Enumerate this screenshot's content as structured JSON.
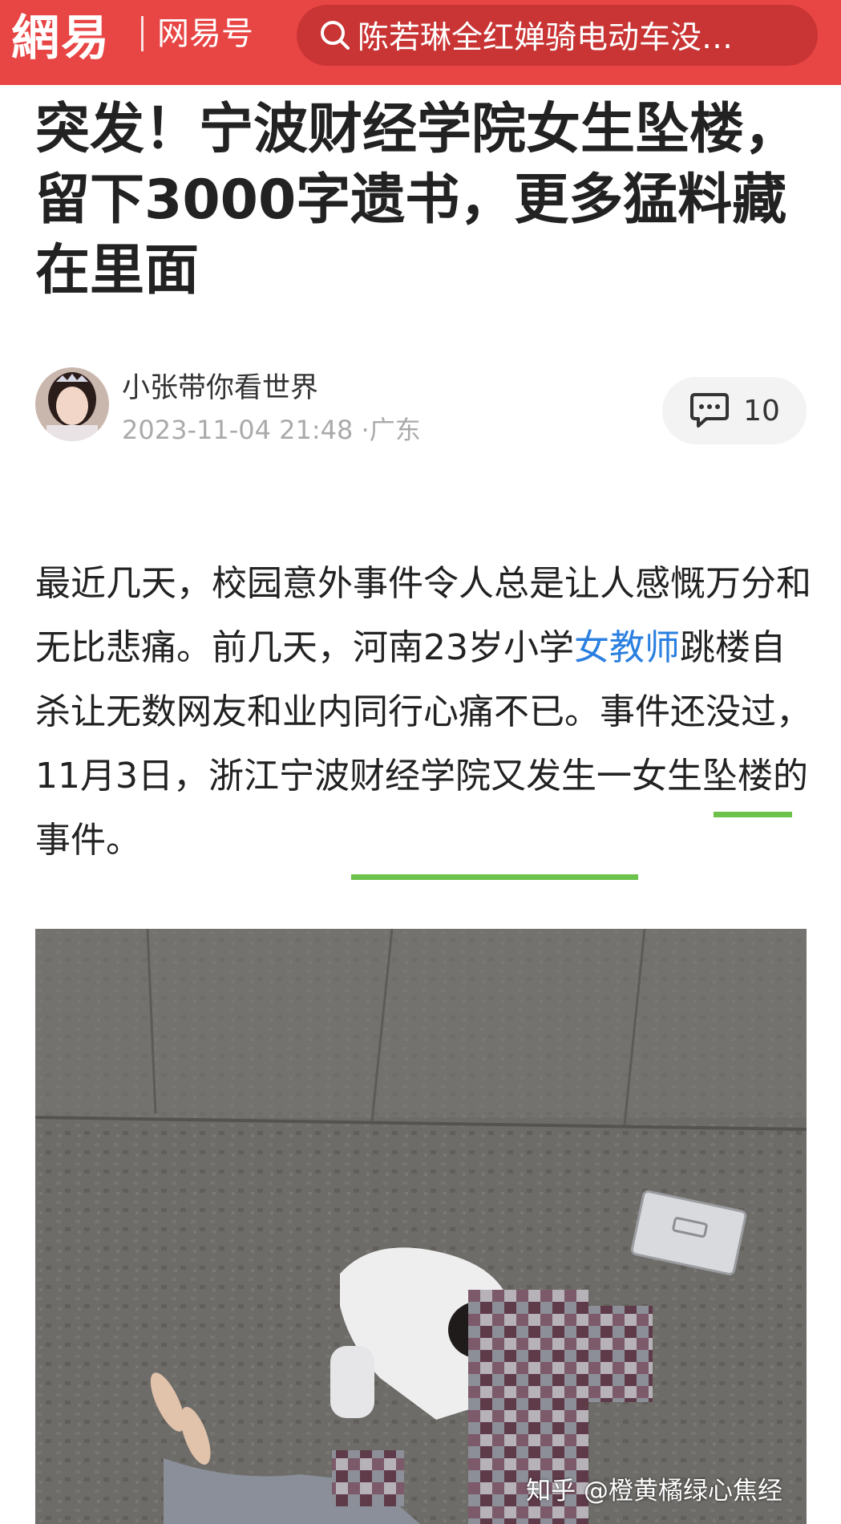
{
  "header": {
    "logo_text": "網易",
    "channel_label": "网易号",
    "search_placeholder": "陈若琳全红婵骑电动车没…",
    "bg_color": "#e84545"
  },
  "article": {
    "title": "突发！宁波财经学院女生坠楼，留下3000字遗书，更多猛料藏在里面",
    "author": {
      "name": "小张带你看世界",
      "avatar_icon": "avatar-icon"
    },
    "date": "2023-11-04 21:48",
    "location": "·广东",
    "comment_count": "10",
    "paragraph": {
      "part1": "最近几天，校园意外事件令人总是让人感慨万分和无比悲痛。前几天，河南23岁小学",
      "link": "女教师",
      "part2": "跳楼自杀让无数网友和业内同行心痛不已。事件还没过，11月3日，浙江宁波财经学院又发生一女生坠楼的事件。"
    }
  },
  "photo": {
    "watermark": "知乎 @橙黄橘绿心焦经"
  },
  "colors": {
    "link": "#2a7fe0",
    "annotation": "#6cc24a"
  }
}
